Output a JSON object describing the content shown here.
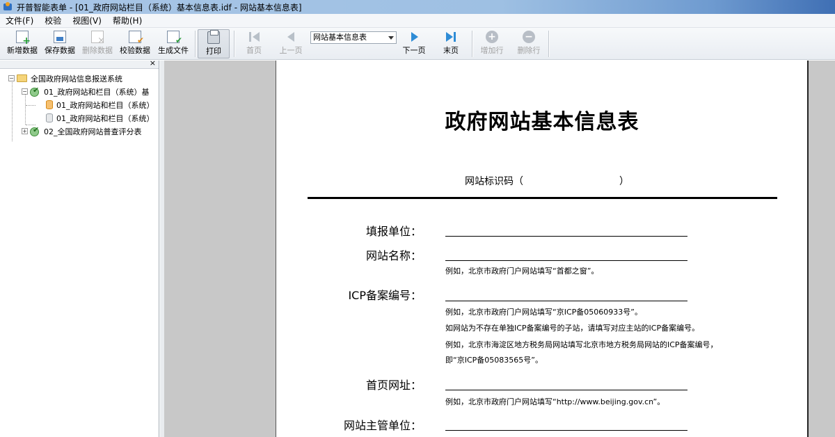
{
  "window": {
    "title": "开普智能表单 - [01_政府网站栏目（系统）基本信息表.idf - 网站基本信息表]"
  },
  "menu": {
    "items": [
      "文件(F)",
      "校验",
      "视图(V)",
      "帮助(H)"
    ]
  },
  "toolbar": {
    "new_label": "新增数据",
    "save_label": "保存数据",
    "delete_label": "删除数据",
    "validate_label": "校验数据",
    "generate_label": "生成文件",
    "print_label": "打印",
    "first_label": "首页",
    "prev_label": "上一页",
    "sheet_select": "网站基本信息表",
    "next_label": "下一页",
    "last_label": "末页",
    "add_row_label": "增加行",
    "delete_row_label": "删除行"
  },
  "tree": {
    "close": "×",
    "root": "全国政府网站信息报送系统",
    "node1": "01_政府网站和栏目（系统）基",
    "node1_child1": "01_政府网站和栏目（系统）",
    "node1_child2": "01_政府网站和栏目（系统）",
    "node2": "02_全国政府网站普查评分表",
    "collapse_symbol": "−",
    "expand_symbol": "+"
  },
  "document": {
    "title": "政府网站基本信息表",
    "site_id_prefix": "网站标识码（",
    "site_id_suffix": "）",
    "fields": {
      "unit": "填报单位：",
      "site_name": "网站名称：",
      "site_name_note": "例如，北京市政府门户网站填写“首都之窗”。",
      "icp": "ICP备案编号：",
      "icp_note1": "例如，北京市政府门户网站填写“京ICP备05060933号”。",
      "icp_note2": "如网站为不存在单独ICP备案编号的子站，请填写对应主站的ICP备案编号。",
      "icp_note3": "例如，北京市海淀区地方税务局网站填写北京市地方税务局网站的ICP备案编号，",
      "icp_note4": "即“京ICP备05083565号”。",
      "homepage": "首页网址：",
      "homepage_note": "例如，北京市政府门户网站填写“http://www.beijing.gov.cn”。",
      "supervisor": "网站主管单位："
    }
  }
}
